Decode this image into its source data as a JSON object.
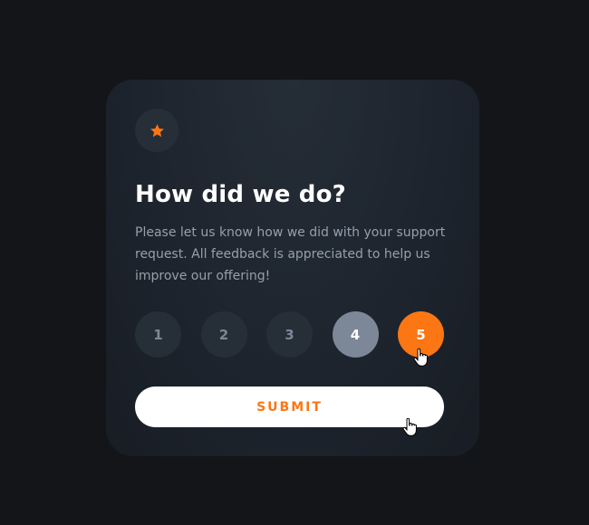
{
  "card": {
    "icon": "star-icon",
    "title": "How did we do?",
    "description": "Please let us know how we did with your support request. All feedback is appreciated to help us improve our offering!"
  },
  "ratings": {
    "options": [
      "1",
      "2",
      "3",
      "4",
      "5"
    ],
    "hovered": "4",
    "selected": "5"
  },
  "submit": {
    "label": "SUBMIT"
  },
  "colors": {
    "accent": "#fc7614",
    "background": "#131518",
    "card": "#1f2630",
    "circle": "#262e38",
    "muted": "#7c8798",
    "text_secondary": "#969fad",
    "white": "#ffffff"
  }
}
